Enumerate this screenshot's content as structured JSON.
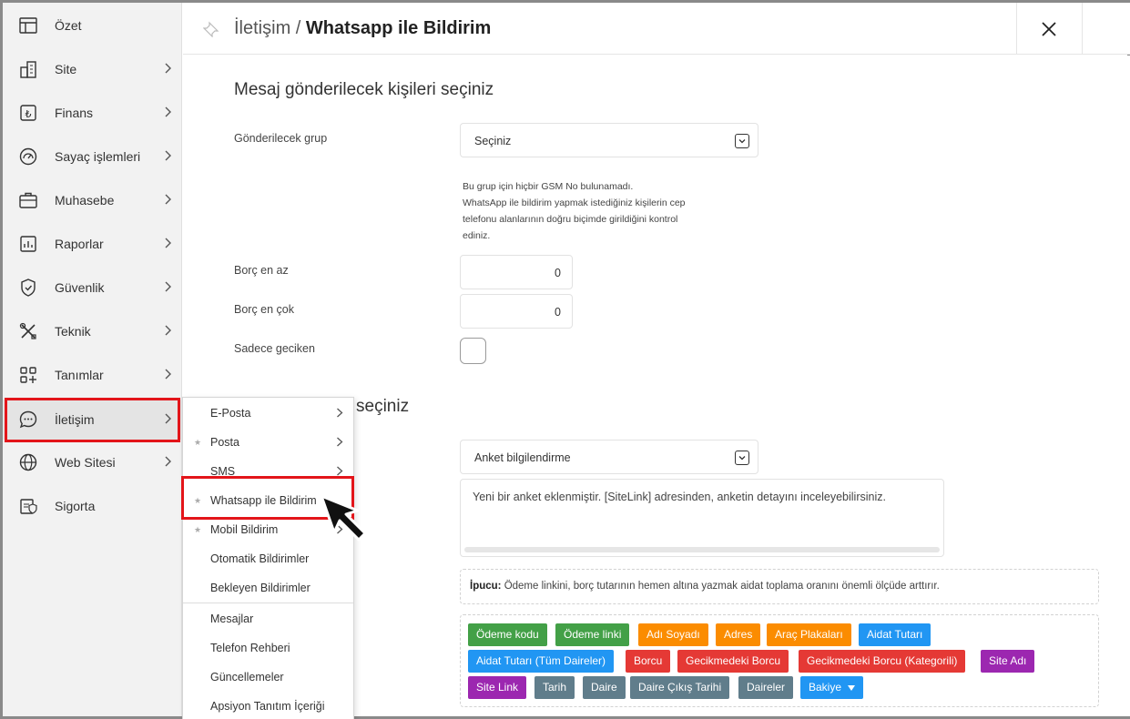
{
  "sidebar": {
    "items": [
      {
        "label": "Özet",
        "icon": "table-icon",
        "chevron": false
      },
      {
        "label": "Site",
        "icon": "building-icon",
        "chevron": true
      },
      {
        "label": "Finans",
        "icon": "lira-icon",
        "chevron": true
      },
      {
        "label": "Sayaç işlemleri",
        "icon": "gauge-icon",
        "chevron": true
      },
      {
        "label": "Muhasebe",
        "icon": "briefcase-icon",
        "chevron": true
      },
      {
        "label": "Raporlar",
        "icon": "chart-icon",
        "chevron": true
      },
      {
        "label": "Güvenlik",
        "icon": "shield-icon",
        "chevron": true
      },
      {
        "label": "Teknik",
        "icon": "tools-icon",
        "chevron": true
      },
      {
        "label": "Tanımlar",
        "icon": "grid-plus-icon",
        "chevron": true
      },
      {
        "label": "İletişim",
        "icon": "chat-icon",
        "chevron": true
      },
      {
        "label": "Web Sitesi",
        "icon": "globe-icon",
        "chevron": true
      },
      {
        "label": "Sigorta",
        "icon": "insurance-icon",
        "chevron": false
      }
    ]
  },
  "header": {
    "breadcrumb_parent": "İletişim",
    "separator": " / ",
    "page_title": "Whatsapp ile Bildirim"
  },
  "main": {
    "section1_title": "Mesaj gönderilecek kişileri seçiniz",
    "group_label": "Gönderilecek grup",
    "group_value": "Seçiniz",
    "help_lines": [
      "Bu grup için hiçbir GSM No bulunamadı.",
      "WhatsApp ile bildirim yapmak istediğiniz kişilerin cep",
      "telefonu alanlarının doğru biçimde girildiğini kontrol",
      "ediniz."
    ],
    "debt_min_label": "Borç en az",
    "debt_min_value": "0",
    "debt_max_label": "Borç en çok",
    "debt_max_value": "0",
    "only_late_label": "Sadece geciken",
    "section2_title_visible": "seçiniz",
    "template_value": "Anket bilgilendirme",
    "message_text": "Yeni bir anket eklenmiştir. [SiteLink] adresinden, anketin detayını inceleyebilirsiniz.",
    "tip_label": "İpucu:",
    "tip_text": " Ödeme linkini, borç tutarının hemen altına yazmak aidat toplama oranını önemli ölçüde arttırır."
  },
  "tags": [
    {
      "label": "Ödeme kodu",
      "color": "#43a047"
    },
    {
      "label": "Ödeme linki",
      "color": "#43a047"
    },
    {
      "label": "Adı Soyadı",
      "color": "#fb8c00"
    },
    {
      "label": "Adres",
      "color": "#fb8c00"
    },
    {
      "label": "Araç Plakaları",
      "color": "#fb8c00"
    },
    {
      "label": "Aidat Tutarı",
      "color": "#2196f3"
    },
    {
      "label": "Aidat Tutarı (Tüm Daireler)",
      "color": "#2196f3"
    },
    {
      "label": "Borcu",
      "color": "#e53935"
    },
    {
      "label": "Gecikmedeki Borcu",
      "color": "#e53935"
    },
    {
      "label": "Gecikmedeki Borcu (Kategorili)",
      "color": "#e53935"
    },
    {
      "label": "Site Adı",
      "color": "#9c27b0"
    },
    {
      "label": "Site Link",
      "color": "#9c27b0"
    },
    {
      "label": "Tarih",
      "color": "#607d8b"
    },
    {
      "label": "Daire",
      "color": "#607d8b"
    },
    {
      "label": "Daire Çıkış Tarihi",
      "color": "#607d8b"
    },
    {
      "label": "Daireler",
      "color": "#607d8b"
    },
    {
      "label": "Bakiye",
      "color": "#2196f3"
    }
  ],
  "submenu": {
    "items": [
      {
        "label": "E-Posta",
        "star": false,
        "chevron": true
      },
      {
        "label": "Posta",
        "star": true,
        "chevron": true
      },
      {
        "label": "SMS",
        "star": false,
        "chevron": true
      },
      {
        "label": "Whatsapp ile Bildirim",
        "star": true,
        "chevron": false
      },
      {
        "label": "Mobil Bildirim",
        "star": true,
        "chevron": true
      },
      {
        "label": "Otomatik Bildirimler",
        "star": false,
        "chevron": false
      },
      {
        "label": "Bekleyen Bildirimler",
        "star": false,
        "chevron": false
      },
      {
        "label": "Mesajlar",
        "star": false,
        "chevron": false
      },
      {
        "label": "Telefon Rehberi",
        "star": false,
        "chevron": false
      },
      {
        "label": "Güncellemeler",
        "star": false,
        "chevron": false
      },
      {
        "label": "Apsiyon Tanıtım İçeriği",
        "star": false,
        "chevron": false
      }
    ]
  },
  "colors": {
    "highlight": "#e3151a",
    "sidebar_bg": "#f2f2f2"
  }
}
